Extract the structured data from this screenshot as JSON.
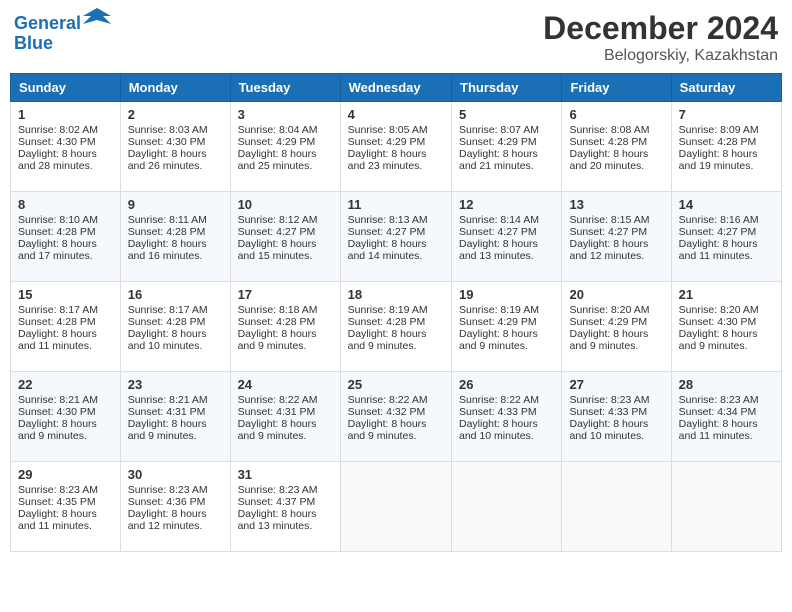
{
  "header": {
    "logo_line1": "General",
    "logo_line2": "Blue",
    "month": "December 2024",
    "location": "Belogorskiy, Kazakhstan"
  },
  "days_of_week": [
    "Sunday",
    "Monday",
    "Tuesday",
    "Wednesday",
    "Thursday",
    "Friday",
    "Saturday"
  ],
  "weeks": [
    [
      {
        "day": "1",
        "lines": [
          "Sunrise: 8:02 AM",
          "Sunset: 4:30 PM",
          "Daylight: 8 hours",
          "and 28 minutes."
        ]
      },
      {
        "day": "2",
        "lines": [
          "Sunrise: 8:03 AM",
          "Sunset: 4:30 PM",
          "Daylight: 8 hours",
          "and 26 minutes."
        ]
      },
      {
        "day": "3",
        "lines": [
          "Sunrise: 8:04 AM",
          "Sunset: 4:29 PM",
          "Daylight: 8 hours",
          "and 25 minutes."
        ]
      },
      {
        "day": "4",
        "lines": [
          "Sunrise: 8:05 AM",
          "Sunset: 4:29 PM",
          "Daylight: 8 hours",
          "and 23 minutes."
        ]
      },
      {
        "day": "5",
        "lines": [
          "Sunrise: 8:07 AM",
          "Sunset: 4:29 PM",
          "Daylight: 8 hours",
          "and 21 minutes."
        ]
      },
      {
        "day": "6",
        "lines": [
          "Sunrise: 8:08 AM",
          "Sunset: 4:28 PM",
          "Daylight: 8 hours",
          "and 20 minutes."
        ]
      },
      {
        "day": "7",
        "lines": [
          "Sunrise: 8:09 AM",
          "Sunset: 4:28 PM",
          "Daylight: 8 hours",
          "and 19 minutes."
        ]
      }
    ],
    [
      {
        "day": "8",
        "lines": [
          "Sunrise: 8:10 AM",
          "Sunset: 4:28 PM",
          "Daylight: 8 hours",
          "and 17 minutes."
        ]
      },
      {
        "day": "9",
        "lines": [
          "Sunrise: 8:11 AM",
          "Sunset: 4:28 PM",
          "Daylight: 8 hours",
          "and 16 minutes."
        ]
      },
      {
        "day": "10",
        "lines": [
          "Sunrise: 8:12 AM",
          "Sunset: 4:27 PM",
          "Daylight: 8 hours",
          "and 15 minutes."
        ]
      },
      {
        "day": "11",
        "lines": [
          "Sunrise: 8:13 AM",
          "Sunset: 4:27 PM",
          "Daylight: 8 hours",
          "and 14 minutes."
        ]
      },
      {
        "day": "12",
        "lines": [
          "Sunrise: 8:14 AM",
          "Sunset: 4:27 PM",
          "Daylight: 8 hours",
          "and 13 minutes."
        ]
      },
      {
        "day": "13",
        "lines": [
          "Sunrise: 8:15 AM",
          "Sunset: 4:27 PM",
          "Daylight: 8 hours",
          "and 12 minutes."
        ]
      },
      {
        "day": "14",
        "lines": [
          "Sunrise: 8:16 AM",
          "Sunset: 4:27 PM",
          "Daylight: 8 hours",
          "and 11 minutes."
        ]
      }
    ],
    [
      {
        "day": "15",
        "lines": [
          "Sunrise: 8:17 AM",
          "Sunset: 4:28 PM",
          "Daylight: 8 hours",
          "and 11 minutes."
        ]
      },
      {
        "day": "16",
        "lines": [
          "Sunrise: 8:17 AM",
          "Sunset: 4:28 PM",
          "Daylight: 8 hours",
          "and 10 minutes."
        ]
      },
      {
        "day": "17",
        "lines": [
          "Sunrise: 8:18 AM",
          "Sunset: 4:28 PM",
          "Daylight: 8 hours",
          "and 9 minutes."
        ]
      },
      {
        "day": "18",
        "lines": [
          "Sunrise: 8:19 AM",
          "Sunset: 4:28 PM",
          "Daylight: 8 hours",
          "and 9 minutes."
        ]
      },
      {
        "day": "19",
        "lines": [
          "Sunrise: 8:19 AM",
          "Sunset: 4:29 PM",
          "Daylight: 8 hours",
          "and 9 minutes."
        ]
      },
      {
        "day": "20",
        "lines": [
          "Sunrise: 8:20 AM",
          "Sunset: 4:29 PM",
          "Daylight: 8 hours",
          "and 9 minutes."
        ]
      },
      {
        "day": "21",
        "lines": [
          "Sunrise: 8:20 AM",
          "Sunset: 4:30 PM",
          "Daylight: 8 hours",
          "and 9 minutes."
        ]
      }
    ],
    [
      {
        "day": "22",
        "lines": [
          "Sunrise: 8:21 AM",
          "Sunset: 4:30 PM",
          "Daylight: 8 hours",
          "and 9 minutes."
        ]
      },
      {
        "day": "23",
        "lines": [
          "Sunrise: 8:21 AM",
          "Sunset: 4:31 PM",
          "Daylight: 8 hours",
          "and 9 minutes."
        ]
      },
      {
        "day": "24",
        "lines": [
          "Sunrise: 8:22 AM",
          "Sunset: 4:31 PM",
          "Daylight: 8 hours",
          "and 9 minutes."
        ]
      },
      {
        "day": "25",
        "lines": [
          "Sunrise: 8:22 AM",
          "Sunset: 4:32 PM",
          "Daylight: 8 hours",
          "and 9 minutes."
        ]
      },
      {
        "day": "26",
        "lines": [
          "Sunrise: 8:22 AM",
          "Sunset: 4:33 PM",
          "Daylight: 8 hours",
          "and 10 minutes."
        ]
      },
      {
        "day": "27",
        "lines": [
          "Sunrise: 8:23 AM",
          "Sunset: 4:33 PM",
          "Daylight: 8 hours",
          "and 10 minutes."
        ]
      },
      {
        "day": "28",
        "lines": [
          "Sunrise: 8:23 AM",
          "Sunset: 4:34 PM",
          "Daylight: 8 hours",
          "and 11 minutes."
        ]
      }
    ],
    [
      {
        "day": "29",
        "lines": [
          "Sunrise: 8:23 AM",
          "Sunset: 4:35 PM",
          "Daylight: 8 hours",
          "and 11 minutes."
        ]
      },
      {
        "day": "30",
        "lines": [
          "Sunrise: 8:23 AM",
          "Sunset: 4:36 PM",
          "Daylight: 8 hours",
          "and 12 minutes."
        ]
      },
      {
        "day": "31",
        "lines": [
          "Sunrise: 8:23 AM",
          "Sunset: 4:37 PM",
          "Daylight: 8 hours",
          "and 13 minutes."
        ]
      },
      {
        "day": "",
        "lines": []
      },
      {
        "day": "",
        "lines": []
      },
      {
        "day": "",
        "lines": []
      },
      {
        "day": "",
        "lines": []
      }
    ]
  ]
}
